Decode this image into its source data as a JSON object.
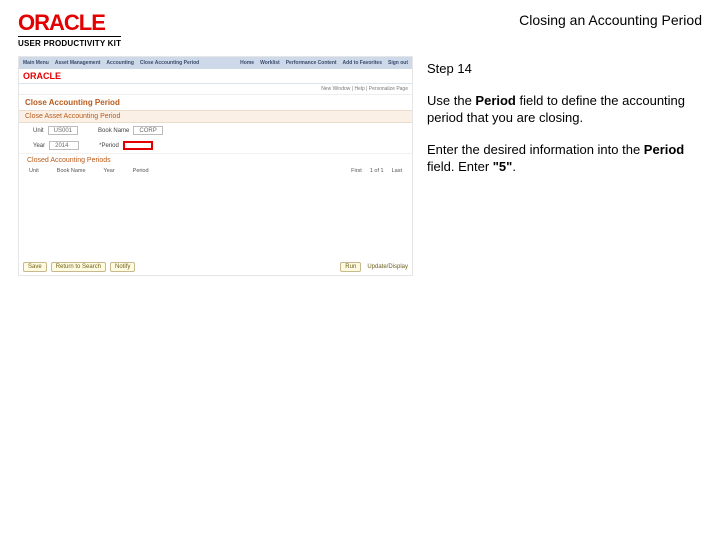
{
  "brand": {
    "name": "ORACLE",
    "subline": "USER PRODUCTIVITY KIT"
  },
  "training_title": "Closing an Accounting Period",
  "instructions": {
    "step_label": "Step 14",
    "p1_a": "Use the ",
    "p1_bold": "Period",
    "p1_b": " field to define the accounting period that you are closing.",
    "p2_a": "Enter the desired information into the ",
    "p2_bold1": "Period",
    "p2_b": " field. Enter ",
    "p2_bold2": "\"5\"",
    "p2_c": "."
  },
  "screenshot": {
    "topbar": {
      "left": "Main Menu",
      "tabs": [
        "Asset Management",
        "Accounting",
        "Close Accounting Period"
      ],
      "right_items": [
        "Home",
        "Worklist",
        "Performance Content",
        "Add to Favorites",
        "Sign out"
      ]
    },
    "oracle_word": "ORACLE",
    "meta_line": "New Window | Help | Personalize Page",
    "section_title": "Close Accounting Period",
    "subtab": "Close Asset Accounting Period",
    "form": {
      "unit_label": "Unit",
      "unit_value": "US001",
      "book_label": "Book Name",
      "book_value": "CORP",
      "year_label": "Year",
      "year_value": "2014",
      "period_label": "*Period",
      "period_value": ""
    },
    "sub2": "Closed Accounting Periods",
    "table": {
      "cols": [
        "Unit",
        "Book Name",
        "Year",
        "Period"
      ],
      "right": [
        "First",
        "1 of 1",
        "Last"
      ]
    },
    "status": {
      "left_chip": [
        "Save",
        "Return to Search",
        "Notify"
      ],
      "right_icon": "Run",
      "right_text": "Update/Display"
    }
  }
}
